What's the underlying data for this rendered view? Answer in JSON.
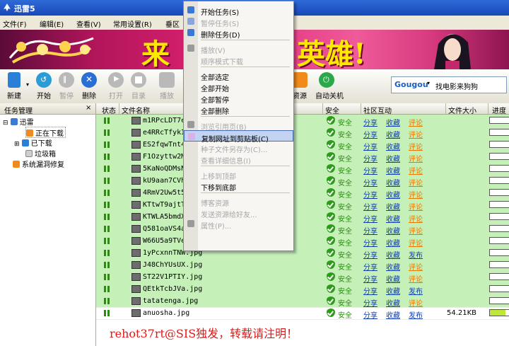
{
  "window": {
    "title": "迅雷5"
  },
  "menu": [
    "文件(F)",
    "编辑(E)",
    "查看(V)",
    "常用设置(R)",
    "垂区"
  ],
  "banner": {
    "slogan": "来",
    "slogan2": "英雄!"
  },
  "toolbar": {
    "buttons": [
      {
        "label": "新建",
        "enabled": true,
        "color": "#2a7fd6"
      },
      {
        "label": "开始",
        "enabled": true,
        "color": "#2a9cd6"
      },
      {
        "label": "暂停",
        "enabled": false,
        "color": "#b9b9b9"
      },
      {
        "label": "删除",
        "enabled": true,
        "color": "#2a6fd6"
      },
      {
        "label": "打开",
        "enabled": false,
        "color": "#b9b9b9"
      },
      {
        "label": "目录",
        "enabled": false,
        "color": "#b9b9b9"
      },
      {
        "label": "播放",
        "enabled": false,
        "color": "#b9b9b9"
      },
      {
        "label": "资源",
        "enabled": true,
        "color": "#f08a1a"
      },
      {
        "label": "自动关机",
        "enabled": true,
        "color": "#2aa84a"
      }
    ],
    "search": {
      "brand": "Gougou",
      "text": "找电影来狗狗"
    }
  },
  "left_panel": {
    "title": "任务管理",
    "close": "×",
    "tree": [
      {
        "label": "迅雷",
        "level": 0
      },
      {
        "label": "正在下载",
        "level": 1,
        "selected": true
      },
      {
        "label": "已下载",
        "level": 1
      },
      {
        "label": "垃圾箱",
        "level": 1
      },
      {
        "label": "系统漏洞修复",
        "level": 0
      }
    ]
  },
  "list": {
    "columns": [
      "状态",
      "文件名称",
      "安全",
      "社区互动",
      "文件大小",
      "进度"
    ],
    "rows": [
      {
        "name": "m1RPcLDT7e.",
        "publish": false,
        "size": "",
        "progress": 0
      },
      {
        "name": "e4RRcTfykI.",
        "publish": false,
        "size": "",
        "progress": 0
      },
      {
        "name": "ES2fqwTnt4.",
        "publish": false,
        "size": "",
        "progress": 0
      },
      {
        "name": "F1Ozyttw2M.",
        "publish": false,
        "size": "",
        "progress": 0
      },
      {
        "name": "5KaNoQDMsN.",
        "publish": false,
        "size": "",
        "progress": 0
      },
      {
        "name": "kU9aan7CVh.",
        "publish": false,
        "size": "",
        "progress": 0
      },
      {
        "name": "4RmV2Uw5t5.",
        "publish": false,
        "size": "",
        "progress": 0
      },
      {
        "name": "KTtwT9ajtT.",
        "publish": false,
        "size": "",
        "progress": 0
      },
      {
        "name": "KTWLA5bmdX.",
        "publish": false,
        "size": "",
        "progress": 0
      },
      {
        "name": "Q581oaVS4a.",
        "publish": false,
        "size": "",
        "progress": 0
      },
      {
        "name": "W66U5a9TVe.",
        "publish": false,
        "size": "",
        "progress": 0
      },
      {
        "name": "1yPcxnnTNW.jpg",
        "publish": true,
        "size": "",
        "progress": 0
      },
      {
        "name": "J48ChYUsUX.jpg",
        "publish": false,
        "size": "",
        "progress": 0
      },
      {
        "name": "ST22V1PTIY.jpg",
        "publish": false,
        "size": "",
        "progress": 0
      },
      {
        "name": "QEtkTcbJVa.jpg",
        "publish": true,
        "size": "",
        "progress": 0
      },
      {
        "name": "tatatenga.jpg",
        "publish": false,
        "size": "",
        "progress": 0
      },
      {
        "name": "anuosha.jpg",
        "publish": true,
        "size": "54.21KB",
        "progress": 0.8
      }
    ],
    "safe_label": "安全",
    "share_label": "分享",
    "fav_label": "收藏",
    "comment_label": "评论",
    "publish_label": "发布"
  },
  "context_menu": {
    "items": [
      {
        "label": "开始任务(S)",
        "enabled": true,
        "icon": true
      },
      {
        "label": "暂停任务(S)",
        "enabled": false,
        "icon": true
      },
      {
        "label": "删除任务(D)",
        "enabled": true,
        "icon": true
      },
      {
        "sep": true
      },
      {
        "label": "播放(V)",
        "enabled": false,
        "icon": true
      },
      {
        "label": "顺序模式下载",
        "enabled": false
      },
      {
        "sep": true
      },
      {
        "label": "全部选定",
        "enabled": true
      },
      {
        "label": "全部开始",
        "enabled": true
      },
      {
        "label": "全部暂停",
        "enabled": true
      },
      {
        "label": "全部删除",
        "enabled": true
      },
      {
        "sep": true
      },
      {
        "label": "浏览引用页(B)",
        "enabled": false,
        "icon": true
      },
      {
        "label": "复制网址到剪贴板(C)",
        "enabled": true,
        "icon": true,
        "highlight": true
      },
      {
        "label": "种子文件另存为(C)...",
        "enabled": false
      },
      {
        "label": "查看详细信息(I)",
        "enabled": false
      },
      {
        "sep": true
      },
      {
        "label": "上移到顶部",
        "enabled": false
      },
      {
        "label": "下移到底部",
        "enabled": true
      },
      {
        "sep": true
      },
      {
        "label": "博客资源",
        "enabled": false
      },
      {
        "label": "发送资源给好友...",
        "enabled": false
      },
      {
        "label": "属性(P)...",
        "enabled": false,
        "icon": true
      }
    ]
  },
  "watermark": "rehot37rt@SIS独发，转载请注明！"
}
